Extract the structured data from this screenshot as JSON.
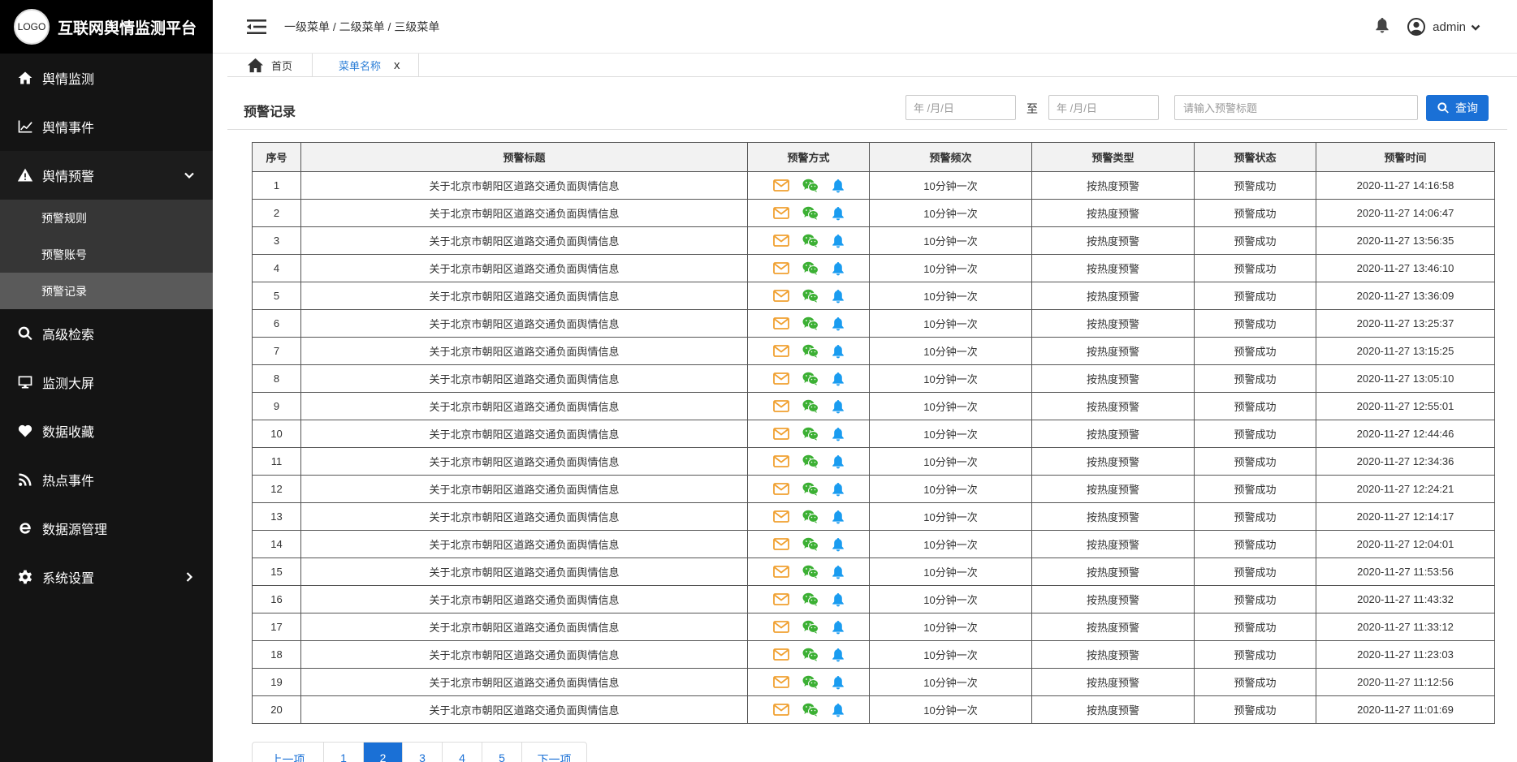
{
  "app": {
    "logo_text": "LOGO",
    "title": "互联网舆情监测平台"
  },
  "sidebar": {
    "items": [
      {
        "label": "舆情监测",
        "icon": "home-icon"
      },
      {
        "label": "舆情事件",
        "icon": "chart-line-icon"
      },
      {
        "label": "舆情预警",
        "icon": "warning-icon",
        "expanded": true
      },
      {
        "label": "高级检索",
        "icon": "search-icon"
      },
      {
        "label": "监测大屏",
        "icon": "monitor-icon"
      },
      {
        "label": "数据收藏",
        "icon": "heart-icon"
      },
      {
        "label": "热点事件",
        "icon": "rss-icon"
      },
      {
        "label": "数据源管理",
        "icon": "ie-icon"
      },
      {
        "label": "系统设置",
        "icon": "gear-icon"
      }
    ],
    "submenu": [
      {
        "label": "预警规则"
      },
      {
        "label": "预警账号"
      },
      {
        "label": "预警记录",
        "active": true
      }
    ]
  },
  "header": {
    "breadcrumb": "一级菜单 / 二级菜单 / 三级菜单",
    "username": "admin"
  },
  "tabs": {
    "home": "首页",
    "menu": "菜单名称",
    "close": "x"
  },
  "toolbar": {
    "title": "预警记录",
    "date_from_placeholder": "年 /月/日",
    "date_sep": "至",
    "date_to_placeholder": "年 /月/日",
    "search_placeholder": "请输入预警标题",
    "search_button": "查询"
  },
  "table": {
    "headers": [
      "序号",
      "预警标题",
      "预警方式",
      "预警频次",
      "预警类型",
      "预警状态",
      "预警时间"
    ],
    "rows": [
      {
        "no": "1",
        "title": "关于北京市朝阳区道路交通负面舆情信息",
        "freq": "10分钟一次",
        "type": "按热度预警",
        "status": "预警成功",
        "time": "2020-11-27 14:16:58"
      },
      {
        "no": "2",
        "title": "关于北京市朝阳区道路交通负面舆情信息",
        "freq": "10分钟一次",
        "type": "按热度预警",
        "status": "预警成功",
        "time": "2020-11-27 14:06:47"
      },
      {
        "no": "3",
        "title": "关于北京市朝阳区道路交通负面舆情信息",
        "freq": "10分钟一次",
        "type": "按热度预警",
        "status": "预警成功",
        "time": "2020-11-27 13:56:35"
      },
      {
        "no": "4",
        "title": "关于北京市朝阳区道路交通负面舆情信息",
        "freq": "10分钟一次",
        "type": "按热度预警",
        "status": "预警成功",
        "time": "2020-11-27 13:46:10"
      },
      {
        "no": "5",
        "title": "关于北京市朝阳区道路交通负面舆情信息",
        "freq": "10分钟一次",
        "type": "按热度预警",
        "status": "预警成功",
        "time": "2020-11-27 13:36:09"
      },
      {
        "no": "6",
        "title": "关于北京市朝阳区道路交通负面舆情信息",
        "freq": "10分钟一次",
        "type": "按热度预警",
        "status": "预警成功",
        "time": "2020-11-27 13:25:37"
      },
      {
        "no": "7",
        "title": "关于北京市朝阳区道路交通负面舆情信息",
        "freq": "10分钟一次",
        "type": "按热度预警",
        "status": "预警成功",
        "time": "2020-11-27 13:15:25"
      },
      {
        "no": "8",
        "title": "关于北京市朝阳区道路交通负面舆情信息",
        "freq": "10分钟一次",
        "type": "按热度预警",
        "status": "预警成功",
        "time": "2020-11-27 13:05:10"
      },
      {
        "no": "9",
        "title": "关于北京市朝阳区道路交通负面舆情信息",
        "freq": "10分钟一次",
        "type": "按热度预警",
        "status": "预警成功",
        "time": "2020-11-27 12:55:01"
      },
      {
        "no": "10",
        "title": "关于北京市朝阳区道路交通负面舆情信息",
        "freq": "10分钟一次",
        "type": "按热度预警",
        "status": "预警成功",
        "time": "2020-11-27 12:44:46"
      },
      {
        "no": "11",
        "title": "关于北京市朝阳区道路交通负面舆情信息",
        "freq": "10分钟一次",
        "type": "按热度预警",
        "status": "预警成功",
        "time": "2020-11-27 12:34:36"
      },
      {
        "no": "12",
        "title": "关于北京市朝阳区道路交通负面舆情信息",
        "freq": "10分钟一次",
        "type": "按热度预警",
        "status": "预警成功",
        "time": "2020-11-27 12:24:21"
      },
      {
        "no": "13",
        "title": "关于北京市朝阳区道路交通负面舆情信息",
        "freq": "10分钟一次",
        "type": "按热度预警",
        "status": "预警成功",
        "time": "2020-11-27 12:14:17"
      },
      {
        "no": "14",
        "title": "关于北京市朝阳区道路交通负面舆情信息",
        "freq": "10分钟一次",
        "type": "按热度预警",
        "status": "预警成功",
        "time": "2020-11-27 12:04:01"
      },
      {
        "no": "15",
        "title": "关于北京市朝阳区道路交通负面舆情信息",
        "freq": "10分钟一次",
        "type": "按热度预警",
        "status": "预警成功",
        "time": "2020-11-27 11:53:56"
      },
      {
        "no": "16",
        "title": "关于北京市朝阳区道路交通负面舆情信息",
        "freq": "10分钟一次",
        "type": "按热度预警",
        "status": "预警成功",
        "time": "2020-11-27 11:43:32"
      },
      {
        "no": "17",
        "title": "关于北京市朝阳区道路交通负面舆情信息",
        "freq": "10分钟一次",
        "type": "按热度预警",
        "status": "预警成功",
        "time": "2020-11-27 11:33:12"
      },
      {
        "no": "18",
        "title": "关于北京市朝阳区道路交通负面舆情信息",
        "freq": "10分钟一次",
        "type": "按热度预警",
        "status": "预警成功",
        "time": "2020-11-27 11:23:03"
      },
      {
        "no": "19",
        "title": "关于北京市朝阳区道路交通负面舆情信息",
        "freq": "10分钟一次",
        "type": "按热度预警",
        "status": "预警成功",
        "time": "2020-11-27 11:12:56"
      },
      {
        "no": "20",
        "title": "关于北京市朝阳区道路交通负面舆情信息",
        "freq": "10分钟一次",
        "type": "按热度预警",
        "status": "预警成功",
        "time": "2020-11-27 11:01:69"
      }
    ],
    "method_icons": [
      "email-icon",
      "wechat-icon",
      "bell-icon"
    ],
    "method_colors": {
      "email": "#f0a030",
      "wechat": "#3cb034",
      "bell": "#1a9cf0"
    }
  },
  "pagination": {
    "prev": "上一项",
    "pages": [
      "1",
      "2",
      "3",
      "4",
      "5"
    ],
    "active": "2",
    "next": "下一项"
  },
  "colors": {
    "sidebar_bg": "#141414",
    "submenu_bg": "#363636",
    "submenu_active": "#5a5a5a",
    "accent": "#1a70d6"
  }
}
